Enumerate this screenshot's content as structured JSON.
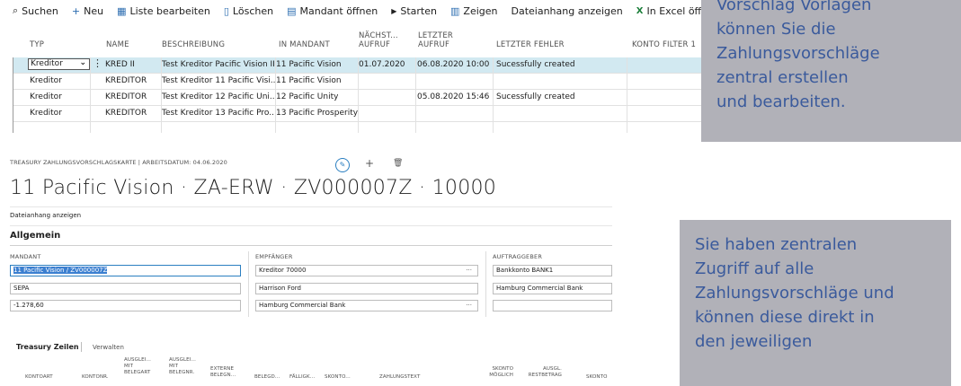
{
  "toolbar": {
    "items": [
      {
        "label": "Suchen",
        "icon": "search-icon",
        "glyph": "⌕"
      },
      {
        "label": "Neu",
        "icon": "plus-icon",
        "glyph": "+"
      },
      {
        "label": "Liste bearbeiten",
        "icon": "edit-list-icon",
        "glyph": "▦"
      },
      {
        "label": "Löschen",
        "icon": "trash-icon",
        "glyph": "🗑"
      },
      {
        "label": "Mandant öffnen",
        "icon": "company-icon",
        "glyph": "▤"
      },
      {
        "label": "Starten",
        "icon": "play-icon",
        "glyph": "▶"
      },
      {
        "label": "Zeigen",
        "icon": "show-icon",
        "glyph": "▥"
      },
      {
        "label": "Dateianhang anzeigen",
        "icon": "",
        "glyph": ""
      },
      {
        "label": "In Excel öffnen",
        "icon": "excel-icon",
        "glyph": "X"
      }
    ]
  },
  "grid": {
    "headers": {
      "typ": "TYP",
      "name": "NAME",
      "beschreibung": "BESCHREIBUNG",
      "in_mandant": "IN MANDANT",
      "naechster_aufruf_1": "NÄCHST...",
      "naechster_aufruf_2": "AUFRUF",
      "letzter_aufruf_1": "LETZTER",
      "letzter_aufruf_2": "AUFRUF",
      "letzter_fehler": "LETZTER FEHLER",
      "konto_filter": "KONTO FILTER 1"
    },
    "rows": [
      {
        "typ": "Kreditor",
        "name": "KRED II",
        "beschreibung": "Test Kreditor Pacific Vision II",
        "mandant": "11 Pacific Vision",
        "naechst": "01.07.2020",
        "letzter": "06.08.2020 10:00",
        "fehler": "Sucessfully created"
      },
      {
        "typ": "Kreditor",
        "name": "KREDITOR",
        "beschreibung": "Test Kreditor 11 Pacific Visi...",
        "mandant": "11 Pacific Vision",
        "naechst": "",
        "letzter": "",
        "fehler": ""
      },
      {
        "typ": "Kreditor",
        "name": "KREDITOR",
        "beschreibung": "Test Kreditor 12 Pacific Uni...",
        "mandant": "12 Pacific Unity",
        "naechst": "",
        "letzter": "05.08.2020 15:46",
        "fehler": "Sucessfully created"
      },
      {
        "typ": "Kreditor",
        "name": "KREDITOR",
        "beschreibung": "Test Kreditor 13 Pacific Pro...",
        "mandant": "13 Pacific Prosperity",
        "naechst": "",
        "letzter": "",
        "fehler": ""
      }
    ]
  },
  "callout_top": {
    "lines": [
      "Vorschlag Vorlagen",
      "können Sie die",
      "Zahlungsvorschläge",
      "zentral erstellen",
      "und bearbeiten."
    ]
  },
  "callout_bottom": {
    "lines": [
      "Sie haben zentralen",
      "Zugriff auf alle",
      "Zahlungsvorschläge und",
      "können diese direkt in",
      "den jeweiligen"
    ]
  },
  "card": {
    "caption": "TREASURY ZAHLUNGSVORSCHLAGSKARTE | ARBEITSDATUM: 04.06.2020",
    "title": "11 Pacific Vision · ZA-ERW · ZV000007Z · 10000",
    "dateianhang": "Dateianhang anzeigen",
    "section": "Allgemein",
    "mandant_label": "MANDANT",
    "mandant_value": "11 Pacific Vision / ZV000007Z",
    "mandant_field2": "SEPA",
    "mandant_field3": "-1.278,60",
    "empfaenger_label": "EMPFÄNGER",
    "empfaenger_value": "Kreditor 70000",
    "empfaenger_field2": "Harrison Ford",
    "empfaenger_field3": "Hamburg Commercial Bank",
    "auftraggeber_label": "AUFTRAGGEBER",
    "auftraggeber_value": "Bankkonto BANK1",
    "auftraggeber_field2": "Hamburg Commercial Bank",
    "auftraggeber_field3": "",
    "ellipsis": "···"
  },
  "lines": {
    "tab_active": "Treasury Zeilen",
    "tab_other": "Verwalten",
    "headers": {
      "kontoart": "KONTOART",
      "kontonr": "KONTONR.",
      "ausgl_belegart": "AUSGLEI... MIT BELEGART",
      "ausgl_belegnr": "AUSGLEI... MIT BELEGNR.",
      "externe": "EXTERNE BELEGN...",
      "belegd": "BELEGD...",
      "faellig": "FÄLLIGK...",
      "skonto": "SKONTO...",
      "zahlungstext": "ZAHLUNGSTEXT",
      "skonto_moeglich": "SKONTO MÖGLICH",
      "ausgl_restbetrag": "AUSGL. RESTBETRAG",
      "skonto2": "SKONTO"
    }
  }
}
